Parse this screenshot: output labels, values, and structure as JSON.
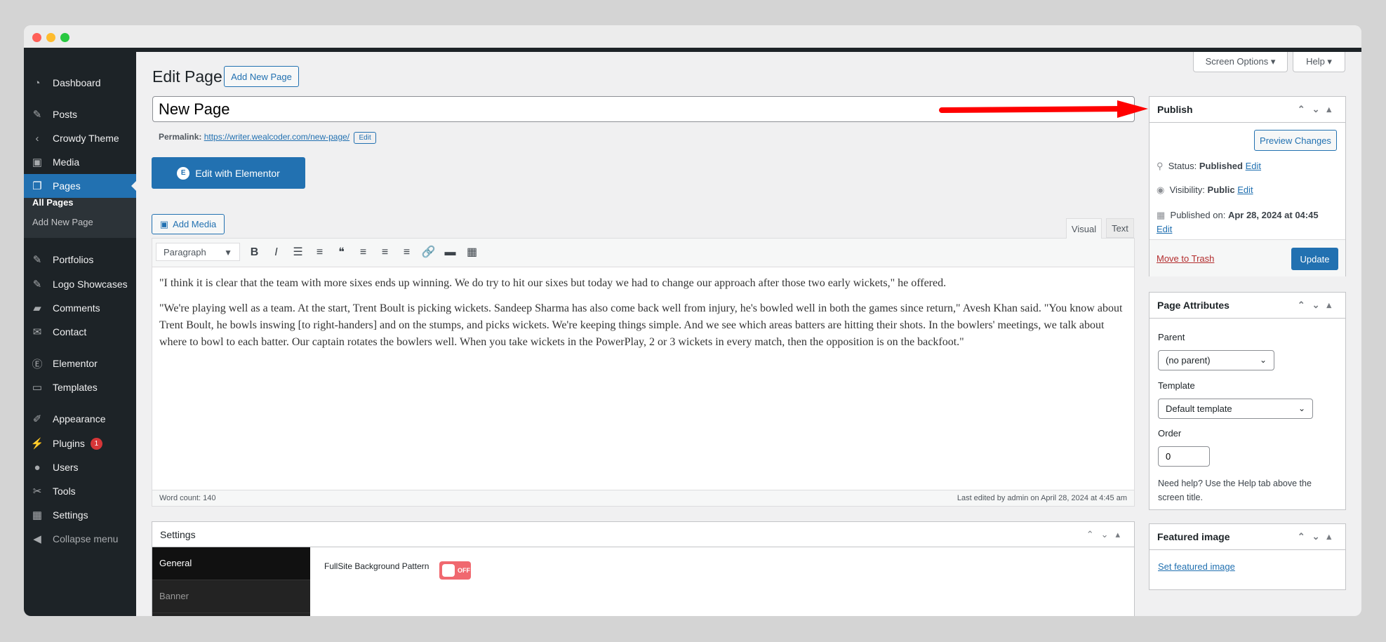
{
  "window": {
    "dots": [
      "#ff5f57",
      "#febc2e",
      "#28c840"
    ]
  },
  "sidebar": {
    "items": [
      {
        "label": "Dashboard",
        "icon": "dashboard-icon",
        "glyph": "◔"
      },
      {
        "label": "Posts",
        "icon": "pin-icon",
        "glyph": "✎"
      },
      {
        "label": "Crowdy Theme",
        "icon": "crowdy-icon",
        "glyph": "‹"
      },
      {
        "label": "Media",
        "icon": "media-icon",
        "glyph": "▣"
      },
      {
        "label": "Pages",
        "icon": "pages-icon",
        "glyph": "❐"
      },
      {
        "label": "Portfolios",
        "icon": "pin-icon",
        "glyph": "✎"
      },
      {
        "label": "Logo Showcases",
        "icon": "pin-icon",
        "glyph": "✎"
      },
      {
        "label": "Comments",
        "icon": "comment-icon",
        "glyph": "▰"
      },
      {
        "label": "Contact",
        "icon": "mail-icon",
        "glyph": "✉"
      },
      {
        "label": "Elementor",
        "icon": "elementor-icon",
        "glyph": "Ⓔ"
      },
      {
        "label": "Templates",
        "icon": "folder-icon",
        "glyph": "▭"
      },
      {
        "label": "Appearance",
        "icon": "brush-icon",
        "glyph": "✐"
      },
      {
        "label": "Plugins",
        "icon": "plug-icon",
        "glyph": "⚡",
        "badge": "1"
      },
      {
        "label": "Users",
        "icon": "user-icon",
        "glyph": "●"
      },
      {
        "label": "Tools",
        "icon": "wrench-icon",
        "glyph": "✂"
      },
      {
        "label": "Settings",
        "icon": "settings-icon",
        "glyph": "▦"
      },
      {
        "label": "Collapse menu",
        "icon": "collapse-icon",
        "glyph": "◀"
      }
    ],
    "submenu": [
      "All Pages",
      "Add New Page"
    ],
    "active_color": "#2271b1"
  },
  "header": {
    "title": "Edit Page",
    "add_new": "Add New Page",
    "screen_options": "Screen Options ▾",
    "help": "Help ▾"
  },
  "post": {
    "title": "New Page",
    "permalink_label": "Permalink:",
    "permalink": "https://writer.wealcoder.com/new-page/",
    "permalink_edit": "Edit",
    "elementor_button": "Edit with Elementor"
  },
  "editor": {
    "add_media": "Add Media",
    "tabs": [
      "Visual",
      "Text"
    ],
    "format": "Paragraph",
    "toolbar": [
      "B",
      "I",
      "☰",
      "≡",
      "❝",
      "≡",
      "≡",
      "≡",
      "🔗",
      "▬",
      "▦"
    ],
    "paragraphs": [
      "\"I think it is clear that the team with more sixes ends up winning. We do try to hit our sixes but today we had to change our approach after those two early wickets,\" he offered.",
      "\"We're playing well as a team. At the start, Trent Boult is picking wickets. Sandeep Sharma has also come back well from injury, he's bowled well in both the games since return,\" Avesh Khan said. \"You know about Trent Boult, he bowls inswing [to right-handers] and on the stumps, and picks wickets. We're keeping things simple. And we see which areas batters are hitting their shots. In the bowlers' meetings, we talk about where to bowl to each batter. Our captain rotates the bowlers well. When you take wickets in the PowerPlay, 2 or 3 wickets in every match, then the opposition is on the backfoot.\""
    ],
    "word_count": "Word count: 140",
    "last_edited": "Last edited by admin on April 28, 2024 at 4:45 am"
  },
  "settings_box": {
    "title": "Settings",
    "tabs": [
      "General",
      "Banner"
    ],
    "field": "FullSite Background Pattern",
    "toggle": "OFF",
    "toggle_color": "#f0686f"
  },
  "publish": {
    "title": "Publish",
    "preview": "Preview Changes",
    "status_label": "Status:",
    "status": "Published",
    "visibility_label": "Visibility:",
    "visibility": "Public",
    "published_label": "Published on:",
    "published": "Apr 28, 2024 at 04:45",
    "edit": "Edit",
    "trash": "Move to Trash",
    "update": "Update"
  },
  "attributes": {
    "title": "Page Attributes",
    "parent_label": "Parent",
    "parent": "(no parent)",
    "template_label": "Template",
    "template": "Default template",
    "order_label": "Order",
    "order": "0",
    "help": "Need help? Use the Help tab above the screen title."
  },
  "featured": {
    "title": "Featured image",
    "link": "Set featured image"
  },
  "annotation": {
    "arrow_color": "#ff0000"
  }
}
